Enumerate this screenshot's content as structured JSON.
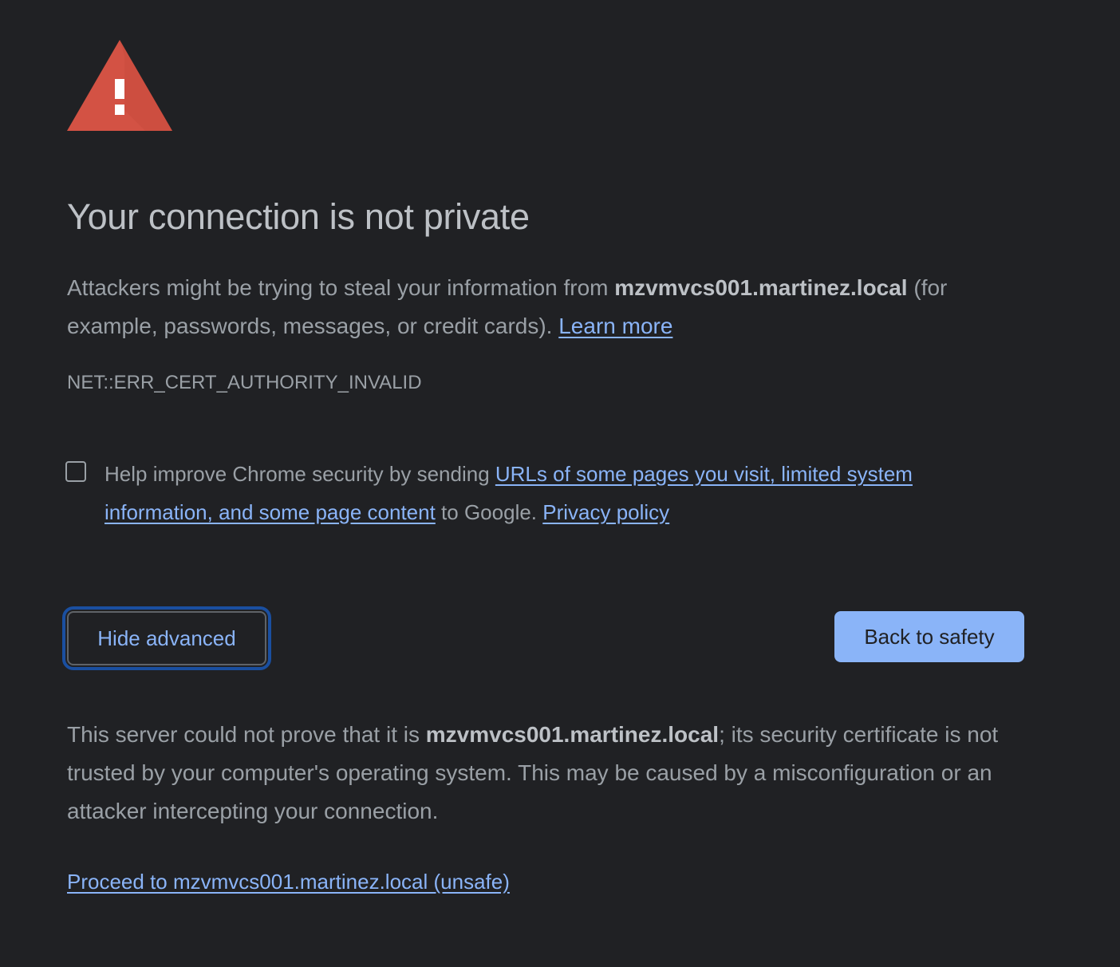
{
  "title": "Your connection is not private",
  "main_message": {
    "before": "Attackers might be trying to steal your information from ",
    "host": "mzvmvcs001.martinez.local",
    "after": " (for example, passwords, messages, or credit cards). ",
    "learn_more": "Learn more"
  },
  "error_code": "NET::ERR_CERT_AUTHORITY_INVALID",
  "optin": {
    "checked": false,
    "before": "Help improve Chrome security by sending ",
    "link_text": "URLs of some pages you visit, limited system information, and some page content",
    "middle": " to Google. ",
    "privacy_link": "Privacy policy"
  },
  "buttons": {
    "hide_advanced": "Hide advanced",
    "back_to_safety": "Back to safety"
  },
  "explanation": {
    "before": "This server could not prove that it is ",
    "host": "mzvmvcs001.martinez.local",
    "after": "; its security certificate is not trusted by your computer's operating system. This may be caused by a misconfiguration or an attacker intercepting your connection."
  },
  "proceed_link": "Proceed to mzvmvcs001.martinez.local (unsafe)",
  "colors": {
    "background": "#202124",
    "text": "#9aa0a6",
    "heading": "#bdc1c6",
    "link": "#8ab4f8",
    "warning_icon": "#d35244",
    "primary_button": "#8ab4f8"
  },
  "icon": "warning-triangle-icon"
}
